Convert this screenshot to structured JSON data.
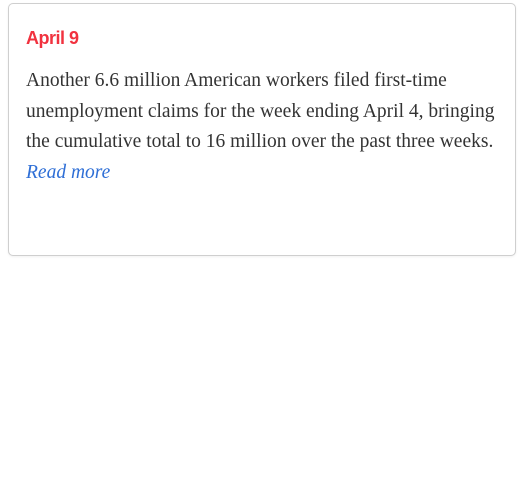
{
  "update": {
    "date": "April 9",
    "text": "Another 6.6 million American workers filed first-time unemployment claims for the week ending April 4, bringing the cumulative total to 16 million over the past three weeks.",
    "link_label": "Read more"
  },
  "colors": {
    "date": "#f1323f",
    "text": "#333333",
    "link": "#2f6fd6",
    "border": "#cfcfcf"
  }
}
